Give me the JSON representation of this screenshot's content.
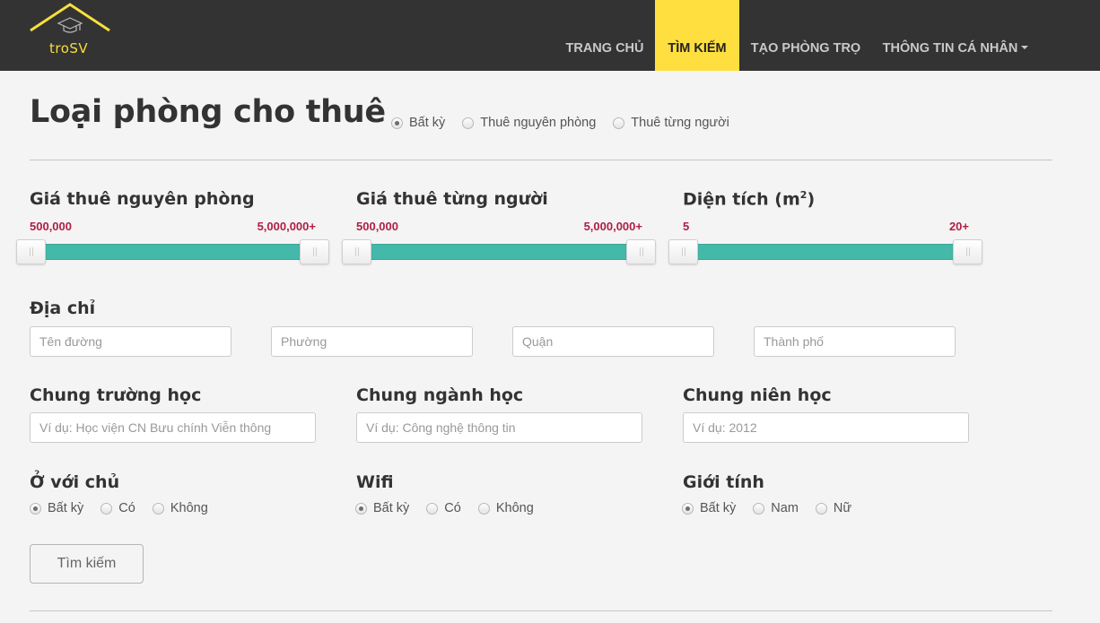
{
  "app": {
    "logo_text": "troSV",
    "brand_color": "#ffdf3f",
    "header_bg": "#333333"
  },
  "nav": {
    "items": [
      {
        "label": "TRANG CHỦ",
        "active": false
      },
      {
        "label": "TÌM KIẾM",
        "active": true
      },
      {
        "label": "TẠO PHÒNG TRỌ",
        "active": false
      },
      {
        "label": "THÔNG TIN CÁ NHÂN",
        "active": false,
        "icon": "caret-down-icon"
      }
    ]
  },
  "room_type": {
    "title": "Loại phòng cho thuê",
    "options": [
      "Bất kỳ",
      "Thuê nguyên phòng",
      "Thuê từng người"
    ],
    "selected": "Bất kỳ"
  },
  "sliders": {
    "whole_room": {
      "label": "Giá thuê nguyên phòng",
      "min_label": "500,000",
      "max_label": "5,000,000+",
      "min_pct": 0,
      "max_pct": 100
    },
    "per_person": {
      "label": "Giá thuê từng người",
      "min_label": "500,000",
      "max_label": "5,000,000+",
      "min_pct": 0,
      "max_pct": 100
    },
    "area": {
      "label_prefix": "Diện tích (m",
      "label_sup": "2",
      "label_suffix": ")",
      "min_label": "5",
      "max_label": "20+",
      "min_pct": 0,
      "max_pct": 100
    },
    "track_color": "#45b9a9",
    "value_color": "#b01e46"
  },
  "address": {
    "label": "Địa chỉ",
    "street_placeholder": "Tên đường",
    "ward_placeholder": "Phường",
    "district_placeholder": "Quận",
    "city_placeholder": "Thành phố"
  },
  "shared": {
    "school_label": "Chung trường học",
    "school_placeholder": "Ví dụ: Học viện CN Bưu chính Viễn thông",
    "major_label": "Chung ngành học",
    "major_placeholder": "Ví dụ: Công nghệ thông tin",
    "year_label": "Chung niên học",
    "year_placeholder": "Ví dụ: 2012"
  },
  "owner": {
    "label": "Ở với chủ",
    "options": [
      "Bất kỳ",
      "Có",
      "Không"
    ],
    "selected": "Bất kỳ"
  },
  "wifi": {
    "label": "Wifi",
    "options": [
      "Bất kỳ",
      "Có",
      "Không"
    ],
    "selected": "Bất kỳ"
  },
  "gender": {
    "label": "Giới tính",
    "options": [
      "Bất kỳ",
      "Nam",
      "Nữ"
    ],
    "selected": "Bất kỳ"
  },
  "search_button": "Tìm kiếm"
}
